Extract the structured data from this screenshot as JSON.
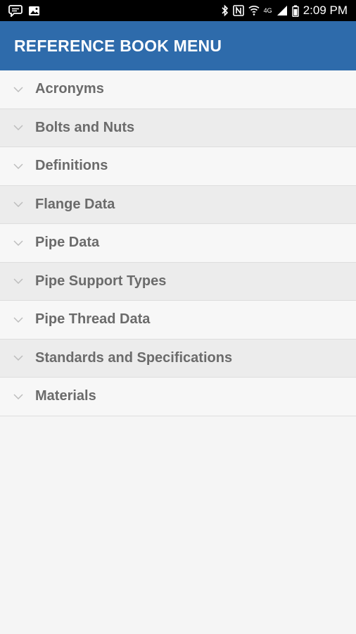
{
  "status_bar": {
    "time": "2:09 PM",
    "network_label": "4G"
  },
  "app_bar": {
    "title": "REFERENCE BOOK MENU"
  },
  "menu": {
    "items": [
      {
        "label": "Acronyms"
      },
      {
        "label": "Bolts and Nuts"
      },
      {
        "label": "Definitions"
      },
      {
        "label": "Flange Data"
      },
      {
        "label": "Pipe Data"
      },
      {
        "label": "Pipe Support Types"
      },
      {
        "label": "Pipe Thread Data"
      },
      {
        "label": "Standards and Specifications"
      },
      {
        "label": "Materials"
      }
    ]
  },
  "colors": {
    "app_bar": "#2e6bab",
    "status_bar": "#000000",
    "label_text": "#6b6b6b"
  }
}
